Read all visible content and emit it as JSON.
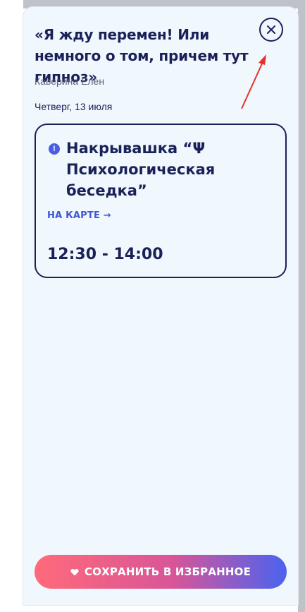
{
  "event": {
    "title": "«Я жду перемен! Или немного о том, причем тут гипноз»",
    "author": "Каверина Елен",
    "date": "Четверг, 13 июля"
  },
  "place": {
    "name": "Накрывашка “Ψ Психологическая беседка”",
    "map_link": "НА КАРТЕ →",
    "time": "12:30 - 14:00"
  },
  "actions": {
    "save_label": "СОХРАНИТЬ В ИЗБРАННОЕ"
  },
  "icons": {
    "close": "close-icon",
    "info": "info-icon",
    "heart": "heart-icon"
  },
  "colors": {
    "text_primary": "#1a2159",
    "accent_link": "#3f56d8",
    "annotation_arrow": "#e8302a",
    "panel_bg": "#f0f7fd"
  }
}
